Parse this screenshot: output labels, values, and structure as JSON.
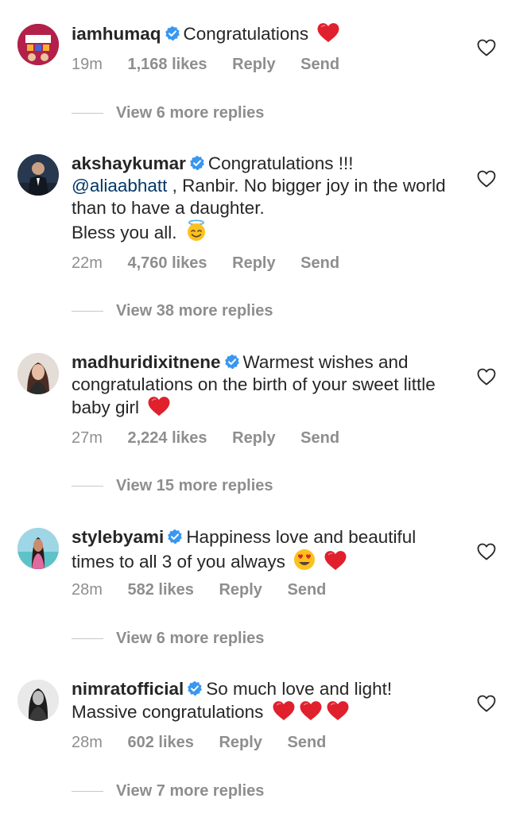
{
  "comments": [
    {
      "username": "iamhumaq",
      "text_before": "Congratulations",
      "emoji": [
        "red-heart"
      ],
      "time": "19m",
      "likes": "1,168 likes",
      "reply": "Reply",
      "send": "Send",
      "view_replies": "View 6 more replies",
      "avatar_icon": "poster-avatar"
    },
    {
      "username": "akshaykumar",
      "line1": "Congratulations !!!",
      "mention": "@aliaabhatt",
      "line2": " , Ranbir. No bigger joy in the world than to have a daughter.",
      "line3": "Bless you all.",
      "emoji": [
        "smiling-face-with-halo"
      ],
      "time": "22m",
      "likes": "4,760 likes",
      "reply": "Reply",
      "send": "Send",
      "view_replies": "View 38 more replies",
      "avatar_icon": "man-suit-avatar"
    },
    {
      "username": "madhuridixitnene",
      "text_before": "Warmest wishes and congratulations on the birth of your sweet little baby girl",
      "emoji": [
        "red-heart"
      ],
      "time": "27m",
      "likes": "2,224 likes",
      "reply": "Reply",
      "send": "Send",
      "view_replies": "View 15 more replies",
      "avatar_icon": "woman-avatar"
    },
    {
      "username": "stylebyami",
      "text_before": "Happiness love and beautiful times to all 3 of you always",
      "emoji": [
        "smiling-face-with-heart-eyes",
        "red-heart"
      ],
      "time": "28m",
      "likes": "582 likes",
      "reply": "Reply",
      "send": "Send",
      "view_replies": "View 6 more replies",
      "avatar_icon": "woman-beach-avatar"
    },
    {
      "username": "nimratofficial",
      "text_before": "So much love and light! Massive congratulations",
      "emoji": [
        "red-heart",
        "red-heart",
        "red-heart"
      ],
      "time": "28m",
      "likes": "602 likes",
      "reply": "Reply",
      "send": "Send",
      "view_replies": "View 7 more replies",
      "avatar_icon": "woman-bw-avatar"
    }
  ],
  "colors": {
    "text": "#262626",
    "meta": "#8e8e8e",
    "verified": "#3897f0",
    "heart": "#e0202c",
    "mention": "#00376b"
  }
}
